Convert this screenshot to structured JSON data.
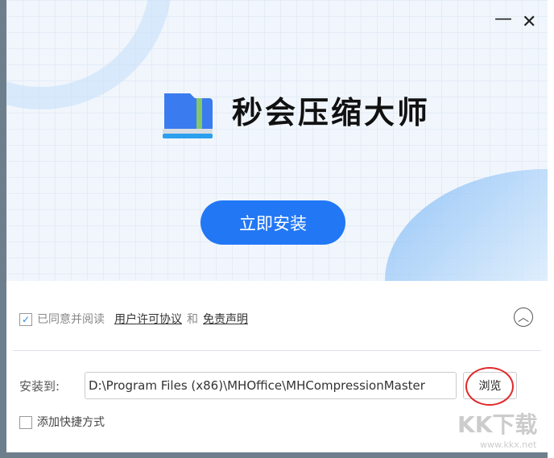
{
  "window": {
    "minimize_icon": "minimize-icon",
    "close_icon": "close-icon"
  },
  "app": {
    "title": "秒会压缩大师"
  },
  "install_button": "立即安装",
  "agreement": {
    "checked": true,
    "text": "已同意并阅读",
    "license_link": "用户许可协议",
    "and": "和",
    "disclaimer_link": "免责声明"
  },
  "install_path": {
    "label": "安装到:",
    "value": "D:\\Program Files (x86)\\MHOffice\\MHCompressionMaster",
    "browse": "浏览"
  },
  "shortcut": {
    "label": "添加快捷方式",
    "checked": false
  },
  "watermark": {
    "text": "KK下载",
    "url": "www.kkx.net"
  }
}
